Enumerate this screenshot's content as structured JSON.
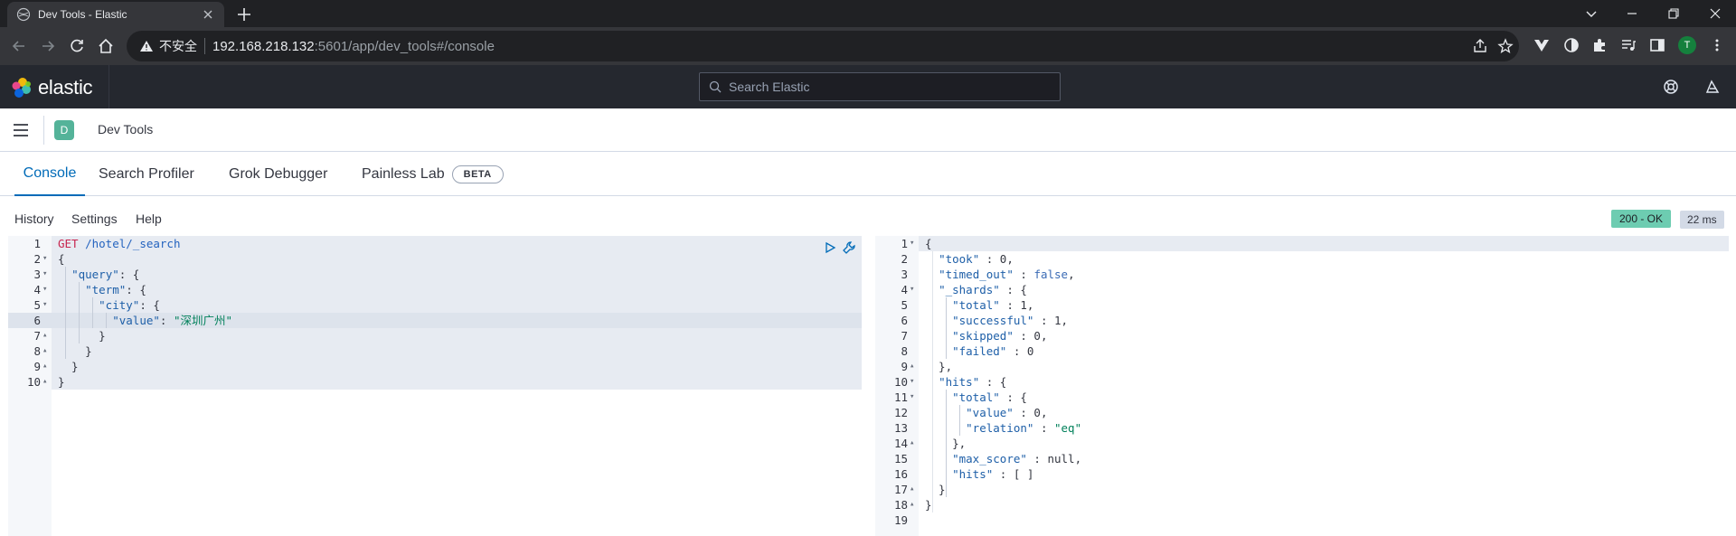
{
  "browser": {
    "tab_title": "Dev Tools - Elastic",
    "security_label": "不安全",
    "url_host": "192.168.218.132",
    "url_rest": ":5601/app/dev_tools#/console",
    "profile_initial": "T"
  },
  "kibana": {
    "brand": "elastic",
    "search_placeholder": "Search Elastic",
    "app_badge": "D",
    "breadcrumb": "Dev Tools"
  },
  "tabs": [
    {
      "label": "Console",
      "active": true
    },
    {
      "label": "Search Profiler",
      "active": false
    },
    {
      "label": "Grok Debugger",
      "active": false
    },
    {
      "label": "Painless Lab",
      "active": false,
      "badge": "BETA"
    }
  ],
  "toolbar": {
    "history": "History",
    "settings": "Settings",
    "help": "Help",
    "status": "200 - OK",
    "time": "22 ms"
  },
  "request": {
    "lines": [
      {
        "n": "1",
        "fold": "",
        "text": "GET /hotel/_search"
      },
      {
        "n": "2",
        "fold": "▾",
        "text": "{"
      },
      {
        "n": "3",
        "fold": "▾",
        "text": "  \"query\": {"
      },
      {
        "n": "4",
        "fold": "▾",
        "text": "    \"term\": {"
      },
      {
        "n": "5",
        "fold": "▾",
        "text": "      \"city\": {"
      },
      {
        "n": "6",
        "fold": "",
        "text": "        \"value\": \"深圳广州\""
      },
      {
        "n": "7",
        "fold": "▴",
        "text": "      }"
      },
      {
        "n": "8",
        "fold": "▴",
        "text": "    }"
      },
      {
        "n": "9",
        "fold": "▴",
        "text": "  }"
      },
      {
        "n": "10",
        "fold": "▴",
        "text": "}"
      }
    ]
  },
  "response": {
    "lines": [
      {
        "n": "1",
        "fold": "▾",
        "text": "{"
      },
      {
        "n": "2",
        "fold": "",
        "text": "  \"took\" : 0,"
      },
      {
        "n": "3",
        "fold": "",
        "text": "  \"timed_out\" : false,"
      },
      {
        "n": "4",
        "fold": "▾",
        "text": "  \"_shards\" : {"
      },
      {
        "n": "5",
        "fold": "",
        "text": "    \"total\" : 1,"
      },
      {
        "n": "6",
        "fold": "",
        "text": "    \"successful\" : 1,"
      },
      {
        "n": "7",
        "fold": "",
        "text": "    \"skipped\" : 0,"
      },
      {
        "n": "8",
        "fold": "",
        "text": "    \"failed\" : 0"
      },
      {
        "n": "9",
        "fold": "▴",
        "text": "  },"
      },
      {
        "n": "10",
        "fold": "▾",
        "text": "  \"hits\" : {"
      },
      {
        "n": "11",
        "fold": "▾",
        "text": "    \"total\" : {"
      },
      {
        "n": "12",
        "fold": "",
        "text": "      \"value\" : 0,"
      },
      {
        "n": "13",
        "fold": "",
        "text": "      \"relation\" : \"eq\""
      },
      {
        "n": "14",
        "fold": "▴",
        "text": "    },"
      },
      {
        "n": "15",
        "fold": "",
        "text": "    \"max_score\" : null,"
      },
      {
        "n": "16",
        "fold": "",
        "text": "    \"hits\" : [ ]"
      },
      {
        "n": "17",
        "fold": "▴",
        "text": "  }"
      },
      {
        "n": "18",
        "fold": "▴",
        "text": "}"
      },
      {
        "n": "19",
        "fold": "",
        "text": ""
      }
    ]
  }
}
